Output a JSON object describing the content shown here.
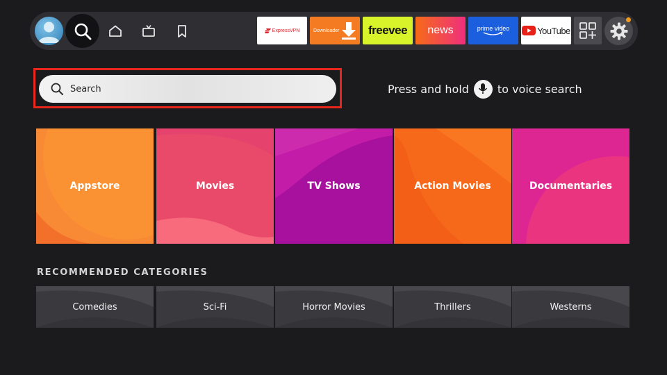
{
  "nav": {
    "icons": [
      "profile-avatar",
      "search-icon",
      "home-icon",
      "tv-icon",
      "bookmark-icon"
    ],
    "apps": {
      "expressvpn": "ExpressVPN",
      "downloader": "Downloader",
      "freevee": "freevee",
      "news": "news",
      "prime_video": "prime video",
      "youtube": "YouTube"
    }
  },
  "search": {
    "placeholder": "Search"
  },
  "voice_hint": {
    "before": "Press and hold",
    "after": "to voice search"
  },
  "categories": [
    "Appstore",
    "Movies",
    "TV Shows",
    "Action Movies",
    "Documentaries"
  ],
  "recommended": {
    "title": "RECOMMENDED CATEGORIES",
    "items": [
      "Comedies",
      "Sci-Fi",
      "Horror Movies",
      "Thrillers",
      "Westerns"
    ]
  },
  "colors": {
    "focus_border": "#e8261b",
    "notification": "#f29a1f",
    "background": "#1b1b1d"
  }
}
